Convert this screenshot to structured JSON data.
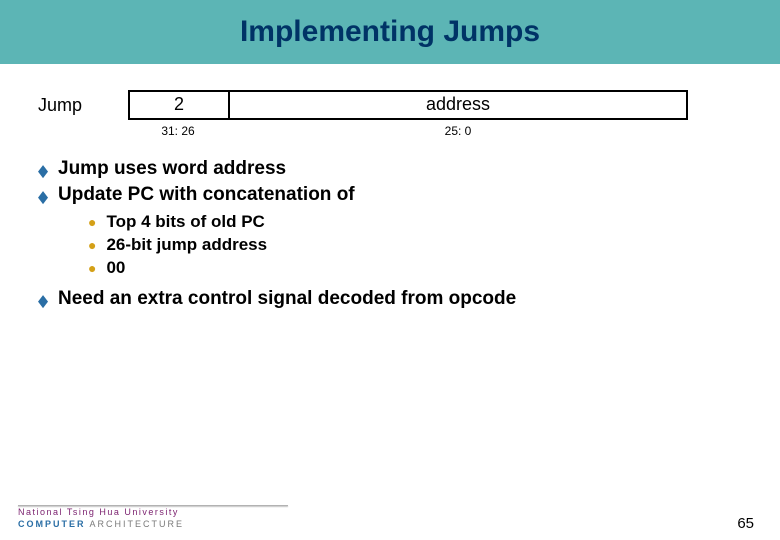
{
  "title": "Implementing Jumps",
  "instruction": {
    "label": "Jump",
    "op": "2",
    "addr": "address",
    "op_bits": "31: 26",
    "addr_bits": "25: 0"
  },
  "bullets": {
    "b1": "Jump uses word address",
    "b2": "Update PC with concatenation of",
    "s1": "Top 4 bits of old PC",
    "s2": "26-bit jump address",
    "s3": "00",
    "b3": "Need an extra control signal decoded from opcode"
  },
  "footer": {
    "university": "National Tsing Hua University",
    "dept1": "COMPUTER",
    "dept2": "ARCHITECTURE",
    "page": "65"
  }
}
